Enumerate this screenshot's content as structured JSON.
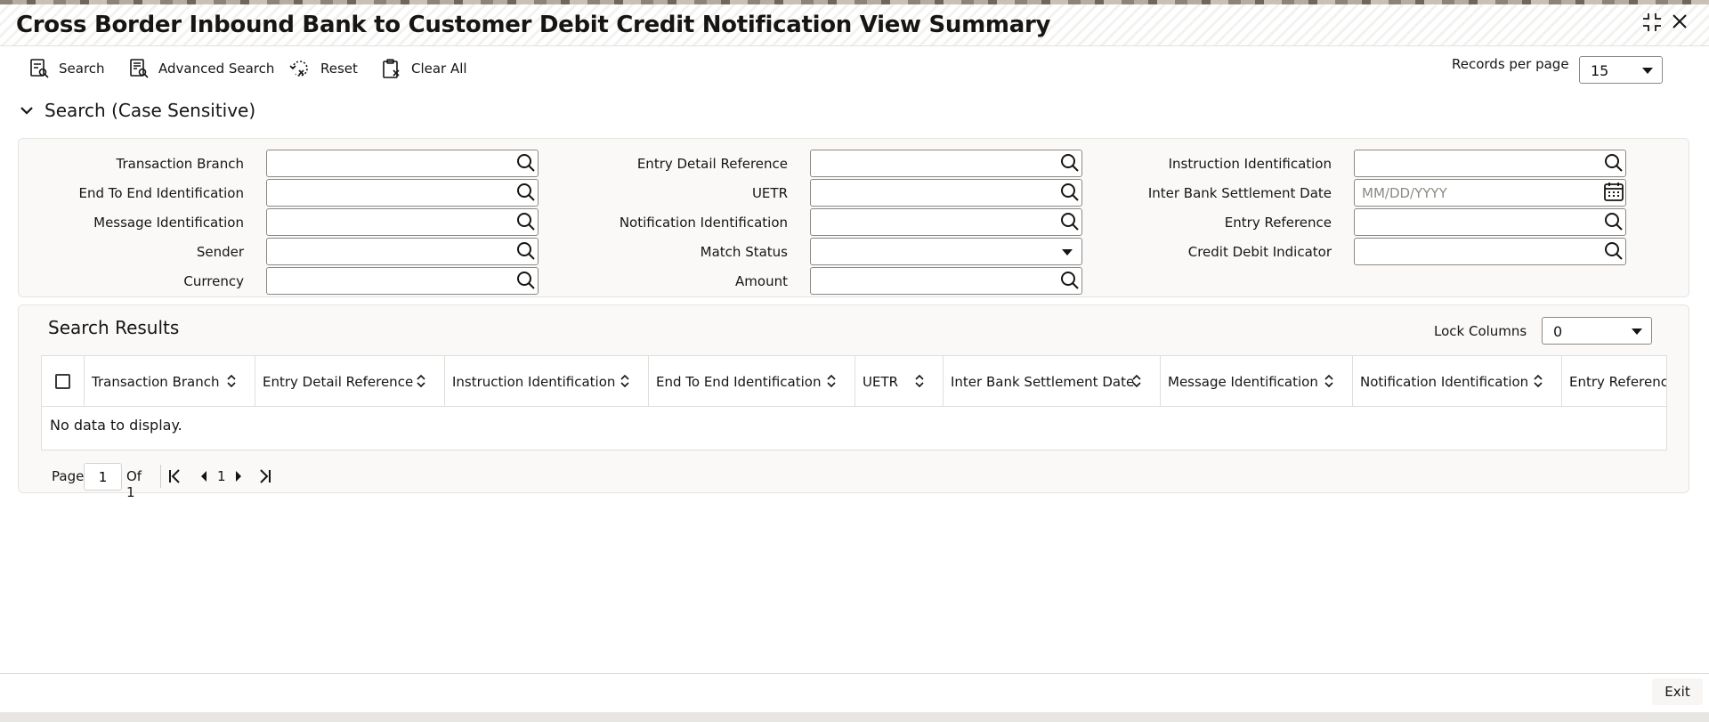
{
  "window": {
    "title": "Cross Border Inbound Bank to Customer Debit Credit Notification View Summary"
  },
  "toolbar": {
    "search_label": "Search",
    "advanced_search_label": "Advanced Search",
    "reset_label": "Reset",
    "clear_all_label": "Clear All",
    "records_per_page_label": "Records per page",
    "records_per_page_value": "15"
  },
  "search_section": {
    "title": "Search (Case Sensitive)",
    "fields": {
      "transaction_branch": {
        "label": "Transaction Branch",
        "value": ""
      },
      "entry_detail_reference": {
        "label": "Entry Detail Reference",
        "value": ""
      },
      "instruction_identification": {
        "label": "Instruction Identification",
        "value": ""
      },
      "end_to_end_identification": {
        "label": "End To End Identification",
        "value": ""
      },
      "uetr": {
        "label": "UETR",
        "value": ""
      },
      "inter_bank_settlement_date": {
        "label": "Inter Bank Settlement Date",
        "value": "",
        "placeholder": "MM/DD/YYYY"
      },
      "message_identification": {
        "label": "Message Identification",
        "value": ""
      },
      "notification_identification": {
        "label": "Notification Identification",
        "value": ""
      },
      "entry_reference": {
        "label": "Entry Reference",
        "value": ""
      },
      "sender": {
        "label": "Sender",
        "value": ""
      },
      "match_status": {
        "label": "Match Status",
        "value": ""
      },
      "credit_debit_indicator": {
        "label": "Credit Debit Indicator",
        "value": ""
      },
      "currency": {
        "label": "Currency",
        "value": ""
      },
      "amount": {
        "label": "Amount",
        "value": ""
      }
    }
  },
  "results": {
    "title": "Search Results",
    "lock_columns_label": "Lock Columns",
    "lock_columns_value": "0",
    "columns": [
      "Transaction Branch",
      "Entry Detail Reference",
      "Instruction Identification",
      "End To End Identification",
      "UETR",
      "Inter Bank Settlement Date",
      "Message Identification",
      "Notification Identification",
      "Entry Reference"
    ],
    "rows": [],
    "empty_message": "No data to display."
  },
  "pagination": {
    "page_label": "Page",
    "current_page": "1",
    "of_label": "Of 1",
    "page_number": "1"
  },
  "footer": {
    "exit_label": "Exit"
  },
  "icons": {
    "restore": "compress-icon",
    "close": "close-icon",
    "search": "search-icon",
    "calendar": "calendar-icon",
    "sort": "sort-icon"
  }
}
